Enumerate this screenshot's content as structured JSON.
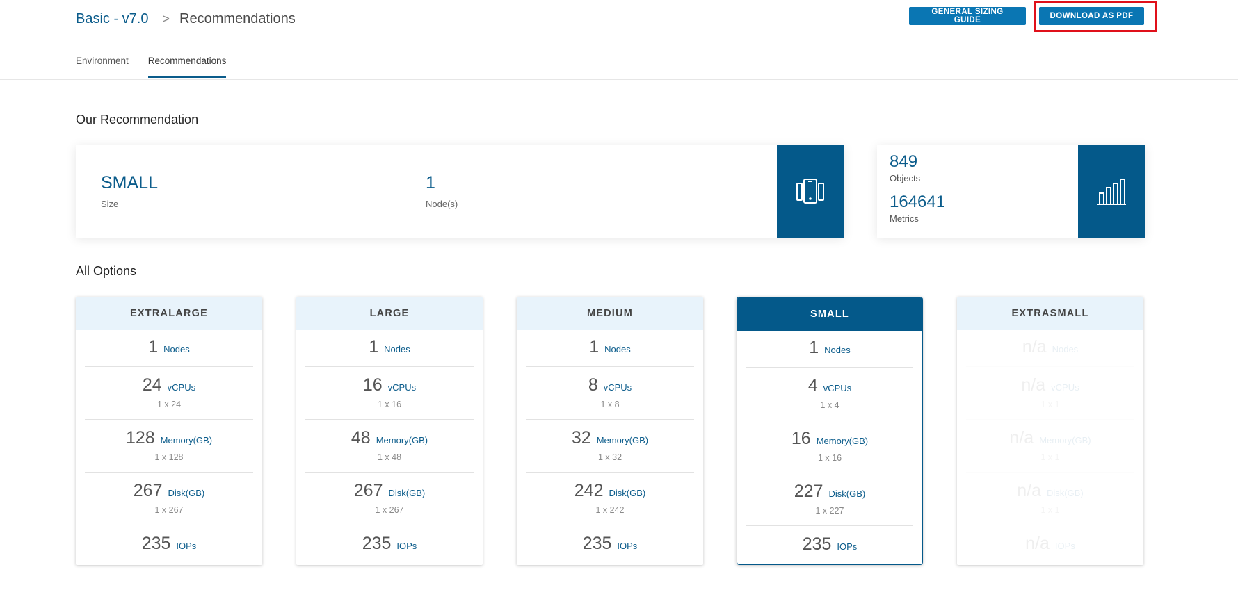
{
  "breadcrumb": {
    "parent": "Basic - v7.0",
    "separator": ">",
    "current": "Recommendations"
  },
  "buttons": {
    "guide": "GENERAL SIZING GUIDE",
    "pdf": "DOWNLOAD AS PDF"
  },
  "tabs": [
    {
      "label": "Environment"
    },
    {
      "label": "Recommendations"
    }
  ],
  "recommendation": {
    "title": "Our Recommendation",
    "size_value": "SMALL",
    "size_label": "Size",
    "nodes_value": "1",
    "nodes_label": "Node(s)",
    "objects_value": "849",
    "objects_label": "Objects",
    "metrics_value": "164641",
    "metrics_label": "Metrics"
  },
  "options_title": "All Options",
  "options": [
    {
      "name": "EXTRALARGE",
      "nodes": "1",
      "vcpus": "24",
      "vcpus_sub": "1 x 24",
      "memory": "128",
      "memory_sub": "1 x 128",
      "disk": "267",
      "disk_sub": "1 x 267",
      "iops": "235"
    },
    {
      "name": "LARGE",
      "nodes": "1",
      "vcpus": "16",
      "vcpus_sub": "1 x 16",
      "memory": "48",
      "memory_sub": "1 x 48",
      "disk": "267",
      "disk_sub": "1 x 267",
      "iops": "235"
    },
    {
      "name": "MEDIUM",
      "nodes": "1",
      "vcpus": "8",
      "vcpus_sub": "1 x 8",
      "memory": "32",
      "memory_sub": "1 x 32",
      "disk": "242",
      "disk_sub": "1 x 242",
      "iops": "235"
    },
    {
      "name": "SMALL",
      "nodes": "1",
      "vcpus": "4",
      "vcpus_sub": "1 x 4",
      "memory": "16",
      "memory_sub": "1 x 16",
      "disk": "227",
      "disk_sub": "1 x 227",
      "iops": "235"
    },
    {
      "name": "EXTRASMALL",
      "nodes": "n/a",
      "vcpus": "n/a",
      "vcpus_sub": "1 x 1",
      "memory": "n/a",
      "memory_sub": "1 x 1",
      "disk": "n/a",
      "disk_sub": "1 x 1",
      "iops": "n/a"
    }
  ],
  "units": {
    "nodes": "Nodes",
    "vcpus": "vCPUs",
    "memory": "Memory(GB)",
    "disk": "Disk(GB)",
    "iops": "IOPs"
  },
  "icons": {
    "size": "devices-icon",
    "stats": "bar-chart-icon"
  },
  "colors": {
    "primary": "#04598a",
    "button": "#0a76b3",
    "highlight": "#e0101a",
    "header_bg": "#e8f3fb"
  }
}
